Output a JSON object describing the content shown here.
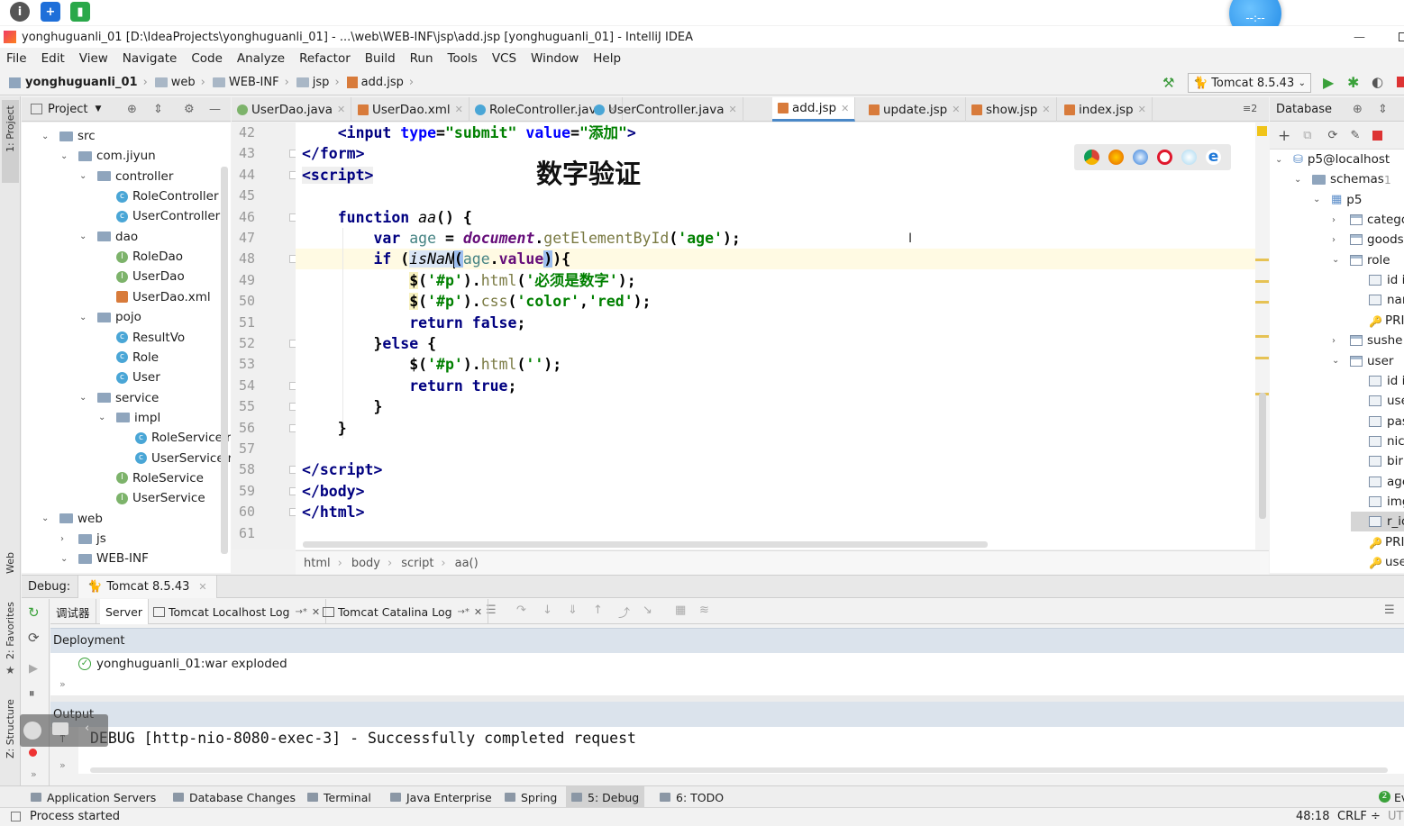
{
  "title_bar": {
    "title": "yonghuguanli_01 [D:\\IdeaProjects\\yonghuguanli_01] - ...\\web\\WEB-INF\\jsp\\add.jsp [yonghuguanli_01] - IntelliJ IDEA",
    "minimize": "—"
  },
  "bubble": {
    "text": "--:--"
  },
  "menu": [
    "File",
    "Edit",
    "View",
    "Navigate",
    "Code",
    "Analyze",
    "Refactor",
    "Build",
    "Run",
    "Tools",
    "VCS",
    "Window",
    "Help"
  ],
  "breadcrumb": [
    "yonghuguanli_01",
    "web",
    "WEB-INF",
    "jsp",
    "add.jsp"
  ],
  "run_config": {
    "label": "Tomcat 8.5.43"
  },
  "project_panel": {
    "title": "Project"
  },
  "tree": [
    {
      "label": "src",
      "indent": 0,
      "kind": "folder",
      "arrow": "v"
    },
    {
      "label": "com.jiyun",
      "indent": 1,
      "kind": "folder",
      "arrow": "v"
    },
    {
      "label": "controller",
      "indent": 2,
      "kind": "folder",
      "arrow": "v"
    },
    {
      "label": "RoleController",
      "indent": 3,
      "kind": "class",
      "arrow": ""
    },
    {
      "label": "UserController",
      "indent": 3,
      "kind": "class",
      "arrow": ""
    },
    {
      "label": "dao",
      "indent": 2,
      "kind": "folder",
      "arrow": "v"
    },
    {
      "label": "RoleDao",
      "indent": 3,
      "kind": "iface",
      "arrow": ""
    },
    {
      "label": "UserDao",
      "indent": 3,
      "kind": "iface",
      "arrow": ""
    },
    {
      "label": "UserDao.xml",
      "indent": 3,
      "kind": "xml",
      "arrow": ""
    },
    {
      "label": "pojo",
      "indent": 2,
      "kind": "folder",
      "arrow": "v"
    },
    {
      "label": "ResultVo",
      "indent": 3,
      "kind": "class",
      "arrow": ""
    },
    {
      "label": "Role",
      "indent": 3,
      "kind": "class",
      "arrow": ""
    },
    {
      "label": "User",
      "indent": 3,
      "kind": "class",
      "arrow": ""
    },
    {
      "label": "service",
      "indent": 2,
      "kind": "folder",
      "arrow": "v"
    },
    {
      "label": "impl",
      "indent": 3,
      "kind": "folder",
      "arrow": "v"
    },
    {
      "label": "RoleServiceIr",
      "indent": 4,
      "kind": "class",
      "arrow": ""
    },
    {
      "label": "UserServiceIr",
      "indent": 4,
      "kind": "class",
      "arrow": ""
    },
    {
      "label": "RoleService",
      "indent": 3,
      "kind": "iface",
      "arrow": ""
    },
    {
      "label": "UserService",
      "indent": 3,
      "kind": "iface",
      "arrow": ""
    },
    {
      "label": "web",
      "indent": 0,
      "kind": "folder",
      "arrow": "v"
    },
    {
      "label": "js",
      "indent": 1,
      "kind": "folder",
      "arrow": ">"
    },
    {
      "label": "WEB-INF",
      "indent": 1,
      "kind": "folder",
      "arrow": "v"
    }
  ],
  "tabs": [
    {
      "label": "UserDao.java",
      "color": "#7db36b",
      "active": false
    },
    {
      "label": "UserDao.xml",
      "color": "#d87b3b",
      "active": false
    },
    {
      "label": "RoleController.java",
      "color": "#4aa6d6",
      "active": false
    },
    {
      "label": "UserController.java",
      "color": "#4aa6d6",
      "active": false
    },
    {
      "label": "add.jsp",
      "color": "#d87b3b",
      "active": true
    },
    {
      "label": "update.jsp",
      "color": "#d87b3b",
      "active": false
    },
    {
      "label": "show.jsp",
      "color": "#d87b3b",
      "active": false
    },
    {
      "label": "index.jsp",
      "color": "#d87b3b",
      "active": false
    }
  ],
  "tab_overflow": "≡2",
  "line_numbers": [
    "42",
    "43",
    "44",
    "45",
    "46",
    "47",
    "48",
    "49",
    "50",
    "51",
    "52",
    "53",
    "54",
    "55",
    "56",
    "57",
    "58",
    "59",
    "60",
    "61"
  ],
  "watermark": "数字验证",
  "editor_breadcrumb": [
    "html",
    "body",
    "script",
    "aa()"
  ],
  "database_panel": {
    "title": "Database"
  },
  "db_tree": [
    {
      "label": "p5@localhost",
      "indent": 0,
      "kind": "db",
      "arrow": "v"
    },
    {
      "label": "schemas",
      "indent": 1,
      "kind": "folder",
      "arrow": "v"
    },
    {
      "label": "1",
      "indent": -1,
      "kind": "count",
      "arrow": ""
    },
    {
      "label": "p5",
      "indent": 2,
      "kind": "schema",
      "arrow": "v"
    },
    {
      "label": "catego",
      "indent": 3,
      "kind": "table",
      "arrow": ">"
    },
    {
      "label": "goods",
      "indent": 3,
      "kind": "table",
      "arrow": ">"
    },
    {
      "label": "role",
      "indent": 3,
      "kind": "table",
      "arrow": "v"
    },
    {
      "label": "id i",
      "indent": 4,
      "kind": "col",
      "arrow": ""
    },
    {
      "label": "nar",
      "indent": 4,
      "kind": "col",
      "arrow": ""
    },
    {
      "label": "PRI",
      "indent": 4,
      "kind": "key",
      "arrow": ""
    },
    {
      "label": "sushe",
      "indent": 3,
      "kind": "table",
      "arrow": ">"
    },
    {
      "label": "user",
      "indent": 3,
      "kind": "table",
      "arrow": "v"
    },
    {
      "label": "id i",
      "indent": 4,
      "kind": "col",
      "arrow": ""
    },
    {
      "label": "use",
      "indent": 4,
      "kind": "col",
      "arrow": ""
    },
    {
      "label": "pas",
      "indent": 4,
      "kind": "col",
      "arrow": ""
    },
    {
      "label": "nic",
      "indent": 4,
      "kind": "col",
      "arrow": ""
    },
    {
      "label": "bir",
      "indent": 4,
      "kind": "col",
      "arrow": ""
    },
    {
      "label": "age",
      "indent": 4,
      "kind": "col",
      "arrow": ""
    },
    {
      "label": "img",
      "indent": 4,
      "kind": "col",
      "arrow": ""
    },
    {
      "label": "r_ic",
      "indent": 4,
      "kind": "col",
      "arrow": ""
    },
    {
      "label": "PRI",
      "indent": 4,
      "kind": "key",
      "arrow": ""
    },
    {
      "label": "use",
      "indent": 4,
      "kind": "key",
      "arrow": ""
    }
  ],
  "debug": {
    "label": "Debug:",
    "config": "Tomcat 8.5.43",
    "tabs": [
      "调试器",
      "Server",
      "Tomcat Localhost Log",
      "Tomcat Catalina Log"
    ],
    "tab_suffix": "→*",
    "deployment_header": "Deployment",
    "deployment_item": "yonghuguanli_01:war exploded",
    "output_header": "Output",
    "output_line": "DEBUG [http-nio-8080-exec-3] - Successfully completed request"
  },
  "left_strip": {
    "project": "1: Project",
    "web": "Web",
    "favorites": "2: Favorites",
    "structure": "Z: Structure"
  },
  "bottom_tools": [
    {
      "label": "Application Servers",
      "active": false
    },
    {
      "label": "Database Changes",
      "active": false
    },
    {
      "label": "Terminal",
      "active": false
    },
    {
      "label": "Java Enterprise",
      "active": false
    },
    {
      "label": "Spring",
      "active": false
    },
    {
      "label": "5: Debug",
      "active": true
    },
    {
      "label": "6: TODO",
      "active": false
    },
    {
      "label": "Ev",
      "active": false
    }
  ],
  "event_count": "2",
  "status": {
    "message": "Process started",
    "position": "48:18",
    "line_sep": "CRLF ÷",
    "encoding": "UT"
  },
  "colors": {
    "accent": "#4a88c7",
    "keyword": "#000080",
    "string": "#008000",
    "tag": "#000080"
  }
}
